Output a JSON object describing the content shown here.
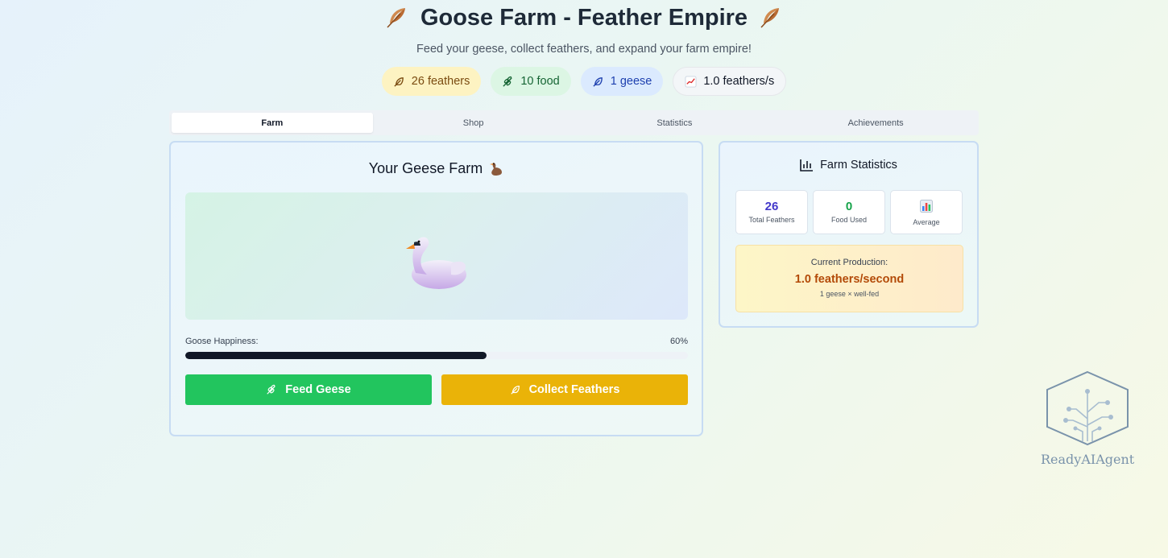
{
  "header": {
    "title": "Goose Farm - Feather Empire",
    "subtitle": "Feed your geese, collect feathers, and expand your farm empire!"
  },
  "resources": {
    "feathers": "26 feathers",
    "food": "10 food",
    "geese": "1 geese",
    "rate": "1.0 feathers/s"
  },
  "tabs": [
    {
      "label": "Farm",
      "active": true
    },
    {
      "label": "Shop",
      "active": false
    },
    {
      "label": "Statistics",
      "active": false
    },
    {
      "label": "Achievements",
      "active": false
    }
  ],
  "farm": {
    "title": "Your Geese Farm",
    "happiness_label": "Goose Happiness:",
    "happiness_value": "60%",
    "happiness_fraction": 0.6,
    "feed_button": "Feed Geese",
    "collect_button": "Collect Feathers"
  },
  "stats": {
    "title": "Farm Statistics",
    "total_feathers": {
      "value": "26",
      "label": "Total Feathers",
      "color": "#4338ca"
    },
    "food_used": {
      "value": "0",
      "label": "Food Used",
      "color": "#16a34a"
    },
    "average": {
      "label": "Average",
      "icon": "bar-chart-emoji-icon"
    },
    "production_label": "Current Production:",
    "production_value": "1.0 feathers/second",
    "production_note": "1 geese × well-fed"
  },
  "colors": {
    "feed_button": "#22c55e",
    "collect_button": "#eab308",
    "production_text": "#b34a08"
  },
  "watermark": {
    "text": "ReadyAIAgent"
  }
}
